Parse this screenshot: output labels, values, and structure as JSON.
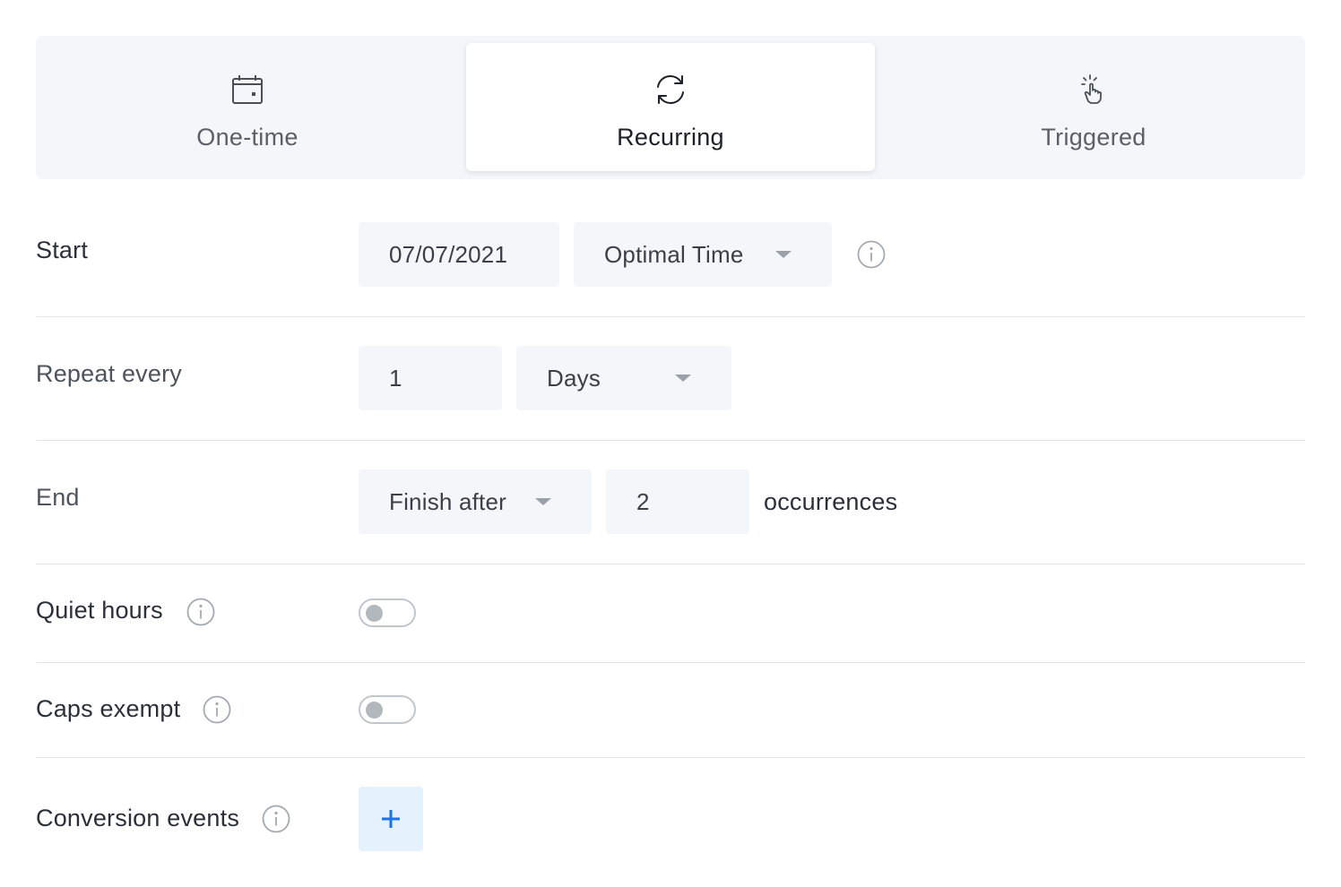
{
  "tabs": [
    {
      "label": "One-time",
      "icon": "calendar-icon",
      "selected": false
    },
    {
      "label": "Recurring",
      "icon": "refresh-icon",
      "selected": true
    },
    {
      "label": "Triggered",
      "icon": "tap-hand-icon",
      "selected": false
    }
  ],
  "start": {
    "label": "Start",
    "date_value": "07/07/2021",
    "time_select_value": "Optimal Time",
    "info_icon": "info-icon"
  },
  "repeat": {
    "label": "Repeat every",
    "interval_value": "1",
    "unit_select_value": "Days"
  },
  "end": {
    "label": "End",
    "mode_select_value": "Finish after",
    "count_value": "2",
    "suffix": "occurrences"
  },
  "quiet_hours": {
    "label": "Quiet hours",
    "info_icon": "info-icon",
    "enabled": false
  },
  "caps_exempt": {
    "label": "Caps exempt",
    "info_icon": "info-icon",
    "enabled": false
  },
  "conversion_events": {
    "label": "Conversion events",
    "info_icon": "info-icon",
    "add_label": "+"
  },
  "colors": {
    "panel_bg": "#f3f7fa",
    "accent": "#1a73e8",
    "add_button_bg": "#e6f1fe"
  }
}
